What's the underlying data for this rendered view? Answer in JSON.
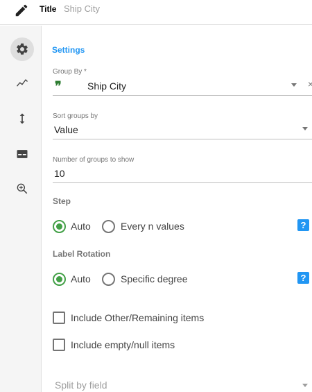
{
  "header": {
    "icon": "pencil-icon",
    "title_label": "Title",
    "title_value": "Ship City"
  },
  "rail": {
    "items": [
      {
        "icon": "gear-icon",
        "active": true
      },
      {
        "icon": "trend-line-icon",
        "active": false
      },
      {
        "icon": "vertical-arrows-icon",
        "active": false
      },
      {
        "icon": "card-icon",
        "active": false
      },
      {
        "icon": "zoom-in-icon",
        "active": false
      }
    ]
  },
  "settings": {
    "section_title": "Settings",
    "group_by": {
      "label": "Group By *",
      "icon": "quote-icon",
      "value": "Ship City",
      "clear": "×"
    },
    "sort_groups": {
      "label": "Sort groups by",
      "value": "Value"
    },
    "num_groups": {
      "label": "Number of groups to show",
      "value": "10"
    },
    "step": {
      "heading": "Step",
      "options": [
        "Auto",
        "Every n values"
      ],
      "selected": "Auto",
      "help": "?"
    },
    "label_rotation": {
      "heading": "Label Rotation",
      "options": [
        "Auto",
        "Specific degree"
      ],
      "selected": "Auto",
      "help": "?"
    },
    "include_other": {
      "label": "Include Other/Remaining items",
      "checked": false
    },
    "include_empty": {
      "label": "Include empty/null items",
      "checked": false
    },
    "split_by": {
      "placeholder": "Split by field"
    }
  },
  "colors": {
    "accent": "#2196f3",
    "radio_on": "#43a047",
    "quote": "#2e7d32"
  }
}
